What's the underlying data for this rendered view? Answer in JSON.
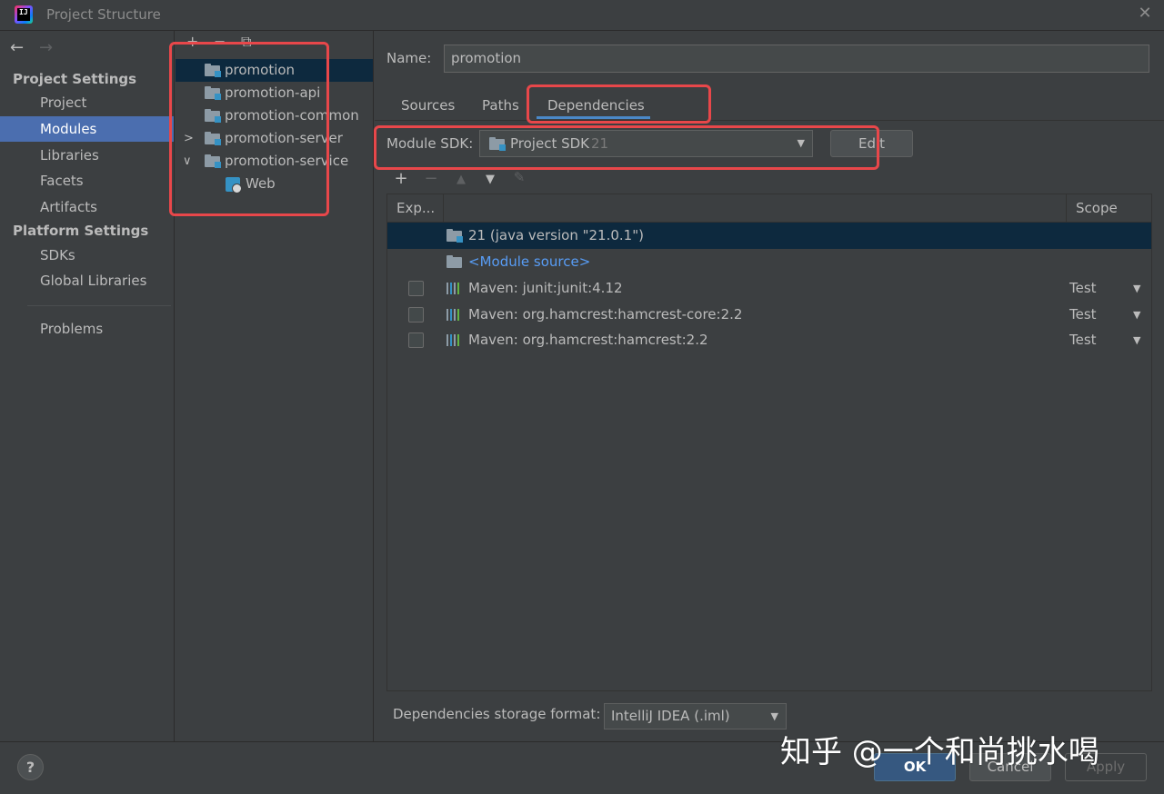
{
  "window": {
    "title": "Project Structure",
    "close_glyph": "✕"
  },
  "nav": {
    "back_glyph": "←",
    "forward_glyph": "→",
    "project_settings_header": "Project Settings",
    "project_items": [
      "Project",
      "Modules",
      "Libraries",
      "Facets",
      "Artifacts"
    ],
    "selected_item": "Modules",
    "platform_settings_header": "Platform Settings",
    "platform_items": [
      "SDKs",
      "Global Libraries"
    ],
    "problems": "Problems"
  },
  "tree": {
    "toolbar": {
      "add": "+",
      "remove": "−",
      "copy": "⧉"
    },
    "modules": [
      {
        "label": "promotion",
        "selected": true
      },
      {
        "label": "promotion-api"
      },
      {
        "label": "promotion-common"
      },
      {
        "label": "promotion-server",
        "expander": ">"
      },
      {
        "label": "promotion-service",
        "expander": "∨"
      },
      {
        "label": "Web",
        "facet": true
      }
    ]
  },
  "detail": {
    "name_label": "Name:",
    "name_value": "promotion",
    "tabs": [
      "Sources",
      "Paths",
      "Dependencies"
    ],
    "active_tab": "Dependencies",
    "module_sdk_label": "Module SDK:",
    "module_sdk_value": "Project SDK",
    "module_sdk_version": "21",
    "edit_label": "Edit",
    "table_toolbar": [
      "+",
      "−",
      "▲",
      "▼",
      "✎"
    ],
    "columns": {
      "export": "Exp...",
      "scope": "Scope"
    },
    "dependencies": [
      {
        "name": "21 (java version \"21.0.1\")",
        "kind": "sdk",
        "selected": true
      },
      {
        "name": "<Module source>",
        "kind": "source"
      },
      {
        "name": "Maven: junit:junit:4.12",
        "kind": "library",
        "scope": "Test",
        "exported": false
      },
      {
        "name": "Maven: org.hamcrest:hamcrest-core:2.2",
        "kind": "library",
        "scope": "Test",
        "exported": false
      },
      {
        "name": "Maven: org.hamcrest:hamcrest:2.2",
        "kind": "library",
        "scope": "Test",
        "exported": false
      }
    ],
    "storage_format_label": "Dependencies storage format:",
    "storage_format_value": "IntelliJ IDEA (.iml)"
  },
  "footer": {
    "help": "?",
    "ok": "OK",
    "cancel": "Cancel",
    "apply": "Apply"
  },
  "watermark": "知乎 @一个和尚挑水喝",
  "colors": {
    "background": "#3c3f41",
    "selection": "#4b6eaf",
    "tree_selection": "#0d293e",
    "accent": "#4a88c7",
    "highlight_box": "#e8474a",
    "link": "#589df6"
  }
}
